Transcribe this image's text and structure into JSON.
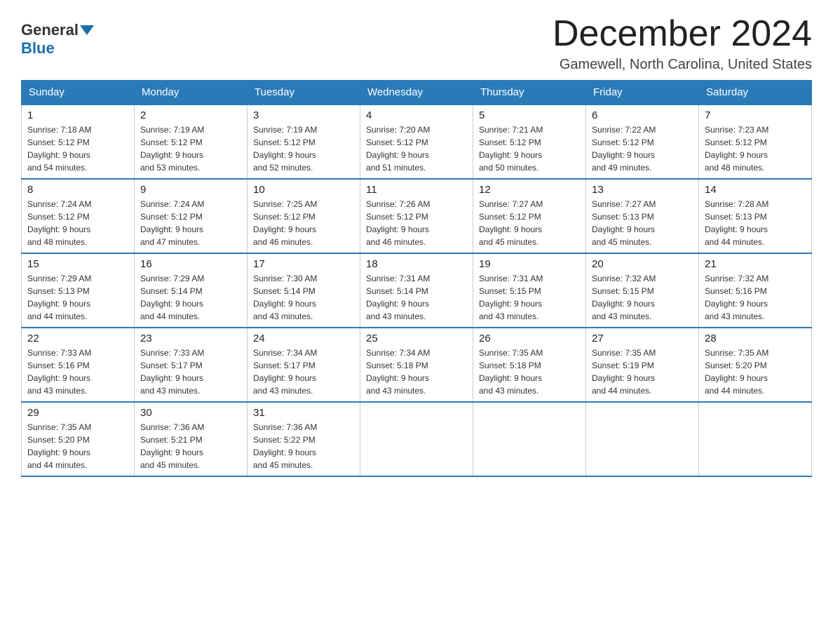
{
  "logo": {
    "general": "General",
    "blue": "Blue"
  },
  "title": {
    "month": "December 2024",
    "location": "Gamewell, North Carolina, United States"
  },
  "weekdays": [
    "Sunday",
    "Monday",
    "Tuesday",
    "Wednesday",
    "Thursday",
    "Friday",
    "Saturday"
  ],
  "weeks": [
    [
      {
        "day": "1",
        "sunrise": "7:18 AM",
        "sunset": "5:12 PM",
        "daylight": "9 hours and 54 minutes."
      },
      {
        "day": "2",
        "sunrise": "7:19 AM",
        "sunset": "5:12 PM",
        "daylight": "9 hours and 53 minutes."
      },
      {
        "day": "3",
        "sunrise": "7:19 AM",
        "sunset": "5:12 PM",
        "daylight": "9 hours and 52 minutes."
      },
      {
        "day": "4",
        "sunrise": "7:20 AM",
        "sunset": "5:12 PM",
        "daylight": "9 hours and 51 minutes."
      },
      {
        "day": "5",
        "sunrise": "7:21 AM",
        "sunset": "5:12 PM",
        "daylight": "9 hours and 50 minutes."
      },
      {
        "day": "6",
        "sunrise": "7:22 AM",
        "sunset": "5:12 PM",
        "daylight": "9 hours and 49 minutes."
      },
      {
        "day": "7",
        "sunrise": "7:23 AM",
        "sunset": "5:12 PM",
        "daylight": "9 hours and 48 minutes."
      }
    ],
    [
      {
        "day": "8",
        "sunrise": "7:24 AM",
        "sunset": "5:12 PM",
        "daylight": "9 hours and 48 minutes."
      },
      {
        "day": "9",
        "sunrise": "7:24 AM",
        "sunset": "5:12 PM",
        "daylight": "9 hours and 47 minutes."
      },
      {
        "day": "10",
        "sunrise": "7:25 AM",
        "sunset": "5:12 PM",
        "daylight": "9 hours and 46 minutes."
      },
      {
        "day": "11",
        "sunrise": "7:26 AM",
        "sunset": "5:12 PM",
        "daylight": "9 hours and 46 minutes."
      },
      {
        "day": "12",
        "sunrise": "7:27 AM",
        "sunset": "5:12 PM",
        "daylight": "9 hours and 45 minutes."
      },
      {
        "day": "13",
        "sunrise": "7:27 AM",
        "sunset": "5:13 PM",
        "daylight": "9 hours and 45 minutes."
      },
      {
        "day": "14",
        "sunrise": "7:28 AM",
        "sunset": "5:13 PM",
        "daylight": "9 hours and 44 minutes."
      }
    ],
    [
      {
        "day": "15",
        "sunrise": "7:29 AM",
        "sunset": "5:13 PM",
        "daylight": "9 hours and 44 minutes."
      },
      {
        "day": "16",
        "sunrise": "7:29 AM",
        "sunset": "5:14 PM",
        "daylight": "9 hours and 44 minutes."
      },
      {
        "day": "17",
        "sunrise": "7:30 AM",
        "sunset": "5:14 PM",
        "daylight": "9 hours and 43 minutes."
      },
      {
        "day": "18",
        "sunrise": "7:31 AM",
        "sunset": "5:14 PM",
        "daylight": "9 hours and 43 minutes."
      },
      {
        "day": "19",
        "sunrise": "7:31 AM",
        "sunset": "5:15 PM",
        "daylight": "9 hours and 43 minutes."
      },
      {
        "day": "20",
        "sunrise": "7:32 AM",
        "sunset": "5:15 PM",
        "daylight": "9 hours and 43 minutes."
      },
      {
        "day": "21",
        "sunrise": "7:32 AM",
        "sunset": "5:16 PM",
        "daylight": "9 hours and 43 minutes."
      }
    ],
    [
      {
        "day": "22",
        "sunrise": "7:33 AM",
        "sunset": "5:16 PM",
        "daylight": "9 hours and 43 minutes."
      },
      {
        "day": "23",
        "sunrise": "7:33 AM",
        "sunset": "5:17 PM",
        "daylight": "9 hours and 43 minutes."
      },
      {
        "day": "24",
        "sunrise": "7:34 AM",
        "sunset": "5:17 PM",
        "daylight": "9 hours and 43 minutes."
      },
      {
        "day": "25",
        "sunrise": "7:34 AM",
        "sunset": "5:18 PM",
        "daylight": "9 hours and 43 minutes."
      },
      {
        "day": "26",
        "sunrise": "7:35 AM",
        "sunset": "5:18 PM",
        "daylight": "9 hours and 43 minutes."
      },
      {
        "day": "27",
        "sunrise": "7:35 AM",
        "sunset": "5:19 PM",
        "daylight": "9 hours and 44 minutes."
      },
      {
        "day": "28",
        "sunrise": "7:35 AM",
        "sunset": "5:20 PM",
        "daylight": "9 hours and 44 minutes."
      }
    ],
    [
      {
        "day": "29",
        "sunrise": "7:35 AM",
        "sunset": "5:20 PM",
        "daylight": "9 hours and 44 minutes."
      },
      {
        "day": "30",
        "sunrise": "7:36 AM",
        "sunset": "5:21 PM",
        "daylight": "9 hours and 45 minutes."
      },
      {
        "day": "31",
        "sunrise": "7:36 AM",
        "sunset": "5:22 PM",
        "daylight": "9 hours and 45 minutes."
      },
      null,
      null,
      null,
      null
    ]
  ],
  "labels": {
    "sunrise": "Sunrise:",
    "sunset": "Sunset:",
    "daylight": "Daylight:"
  }
}
